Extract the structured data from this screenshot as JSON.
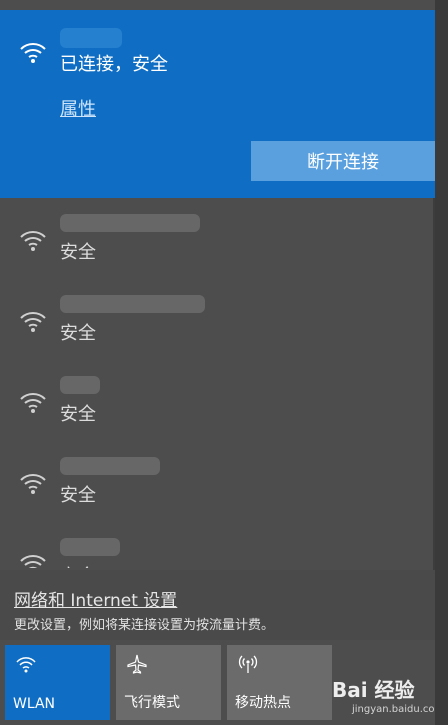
{
  "connected": {
    "status": "已连接，安全",
    "properties_link": "属性",
    "disconnect_label": "断开连接"
  },
  "networks": [
    {
      "security": "安全"
    },
    {
      "security": "安全"
    },
    {
      "security": "安全"
    },
    {
      "security": "安全"
    },
    {
      "security": "安全"
    }
  ],
  "settings": {
    "link": "网络和 Internet 设置",
    "description": "更改设置，例如将某连接设置为按流量计费。"
  },
  "tiles": [
    {
      "label": "WLAN",
      "icon": "wifi-icon",
      "active": true
    },
    {
      "label": "飞行模式",
      "icon": "airplane-icon",
      "active": false
    },
    {
      "label": "移动热点",
      "icon": "hotspot-icon",
      "active": false
    }
  ],
  "watermark": {
    "logo": "Bai 经验",
    "url": "jingyan.baidu.com"
  },
  "colors": {
    "accent": "#0f6ec4",
    "panel": "#4d4d4d",
    "tile": "#6b6b6b"
  }
}
